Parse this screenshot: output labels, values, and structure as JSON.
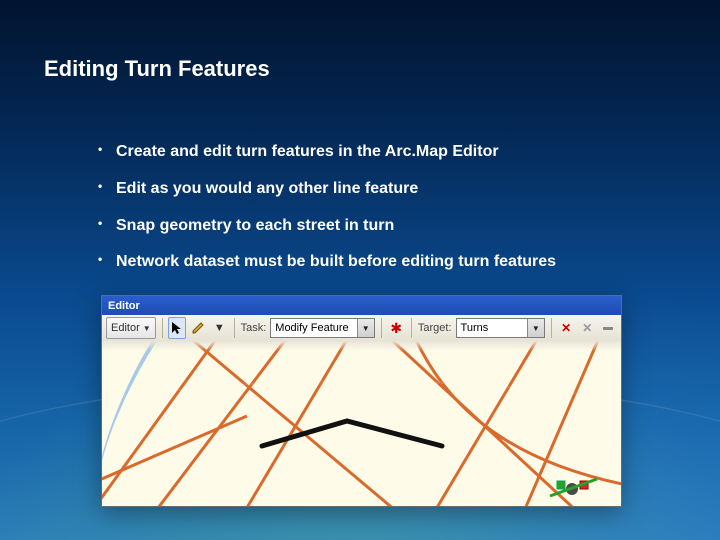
{
  "title": "Editing Turn Features",
  "bullets": [
    "Create and edit turn features in the Arc.Map Editor",
    "Edit as you would any other line feature",
    "Snap geometry to each street in turn",
    "Network dataset must be built before editing turn features"
  ],
  "screenshot": {
    "window_title": "Editor",
    "menu_button": "Editor",
    "task_label": "Task:",
    "task_value": "Modify Feature",
    "target_label": "Target:",
    "target_value": "Turns"
  }
}
